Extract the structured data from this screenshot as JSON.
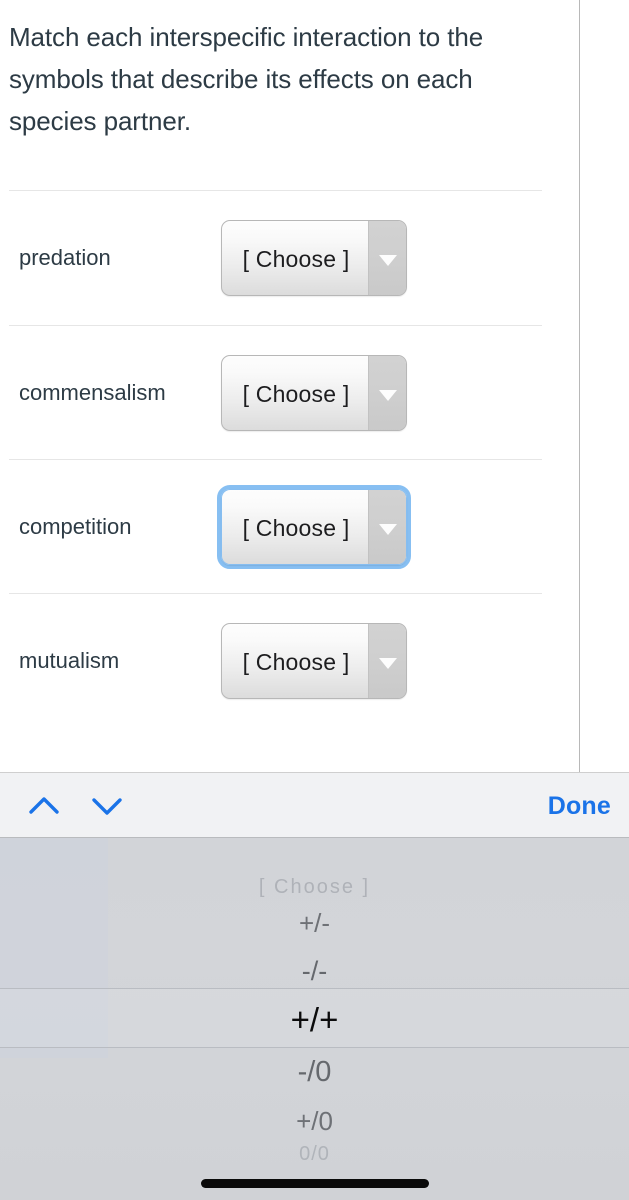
{
  "question": {
    "text": "Match each interspecific interaction to the symbols that describe its effects on each species partner."
  },
  "match_rows": [
    {
      "label": "predation",
      "select_value": "[ Choose ]",
      "focused": false
    },
    {
      "label": "commensalism",
      "select_value": "[ Choose ]",
      "focused": false
    },
    {
      "label": "competition",
      "select_value": "[ Choose ]",
      "focused": true
    },
    {
      "label": "mutualism",
      "select_value": "[ Choose ]",
      "focused": false
    }
  ],
  "picker": {
    "toolbar": {
      "previous_icon": "chevron-up-icon",
      "next_icon": "chevron-down-icon",
      "done_label": "Done",
      "accent_color": "#1a73e8"
    },
    "options": [
      {
        "label": "[ Choose ]",
        "selected": false
      },
      {
        "label": "+/-",
        "selected": false
      },
      {
        "label": "-/-",
        "selected": false
      },
      {
        "label": "+/+",
        "selected": true
      },
      {
        "label": "-/0",
        "selected": false
      },
      {
        "label": "+/0",
        "selected": false
      },
      {
        "label": "0/0",
        "selected": false
      }
    ],
    "selected_value": "+/+"
  },
  "colors": {
    "text": "#2d3b45",
    "accent": "#1a73e8",
    "focus_ring": "#87bff2",
    "wheel_bg": "#d2d4d8"
  }
}
